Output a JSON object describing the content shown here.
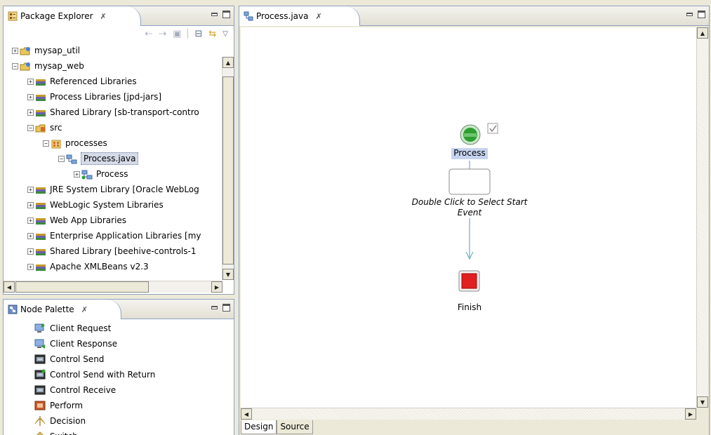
{
  "package_explorer": {
    "title": "Package Explorer",
    "close_glyph": "✗",
    "toolbar": [
      "back-arrow-icon",
      "forward-arrow-icon",
      "up-folder-icon",
      "collapse-all-icon",
      "link-with-editor-icon",
      "view-menu-icon"
    ],
    "tree": [
      {
        "label": "mysap_util",
        "depth": 0,
        "expander": "+",
        "icon": "project-icon"
      },
      {
        "label": "mysap_web",
        "depth": 0,
        "expander": "−",
        "icon": "project-icon"
      },
      {
        "label": "Referenced Libraries",
        "depth": 1,
        "expander": "+",
        "icon": "library-icon"
      },
      {
        "label": "Process Libraries [jpd-jars]",
        "depth": 1,
        "expander": "+",
        "icon": "library-icon"
      },
      {
        "label": "Shared Library [sb-transport-contro",
        "depth": 1,
        "expander": "+",
        "icon": "library-icon"
      },
      {
        "label": "src",
        "depth": 1,
        "expander": "−",
        "icon": "source-folder-icon"
      },
      {
        "label": "processes",
        "depth": 2,
        "expander": "−",
        "icon": "package-icon"
      },
      {
        "label": "Process.java",
        "depth": 3,
        "expander": "−",
        "icon": "process-file-icon",
        "selected": true
      },
      {
        "label": "Process",
        "depth": 4,
        "expander": "+",
        "icon": "process-class-icon"
      },
      {
        "label": "JRE System Library [Oracle WebLog",
        "depth": 1,
        "expander": "+",
        "icon": "library-icon"
      },
      {
        "label": "WebLogic System Libraries",
        "depth": 1,
        "expander": "+",
        "icon": "library-icon"
      },
      {
        "label": "Web App Libraries",
        "depth": 1,
        "expander": "+",
        "icon": "library-icon"
      },
      {
        "label": "Enterprise Application Libraries [my",
        "depth": 1,
        "expander": "+",
        "icon": "library-icon"
      },
      {
        "label": "Shared Library [beehive-controls-1",
        "depth": 1,
        "expander": "+",
        "icon": "library-icon"
      },
      {
        "label": "Apache XMLBeans v2.3",
        "depth": 1,
        "expander": "+",
        "icon": "library-icon"
      }
    ]
  },
  "node_palette": {
    "title": "Node Palette",
    "close_glyph": "✗",
    "items": [
      {
        "label": "Client Request",
        "icon": "client-request-icon"
      },
      {
        "label": "Client Response",
        "icon": "client-response-icon"
      },
      {
        "label": "Control Send",
        "icon": "control-send-icon"
      },
      {
        "label": "Control Send with Return",
        "icon": "control-send-return-icon"
      },
      {
        "label": "Control Receive",
        "icon": "control-receive-icon"
      },
      {
        "label": "Perform",
        "icon": "perform-icon"
      },
      {
        "label": "Decision",
        "icon": "decision-icon"
      },
      {
        "label": "Switch",
        "icon": "switch-icon"
      }
    ]
  },
  "editor": {
    "tab_title": "Process.java",
    "close_glyph": "✗",
    "start_node_label": "Process",
    "start_event_prompt": "Double Click to Select Start Event",
    "finish_label": "Finish",
    "bottom_tabs": [
      "Design",
      "Source"
    ],
    "active_bottom_tab": "Design"
  },
  "colors": {
    "start_green": "#2e9e2e",
    "finish_red": "#e02020",
    "connector_blue": "#5b8fd6",
    "selection_blue": "#c6d3ef"
  }
}
